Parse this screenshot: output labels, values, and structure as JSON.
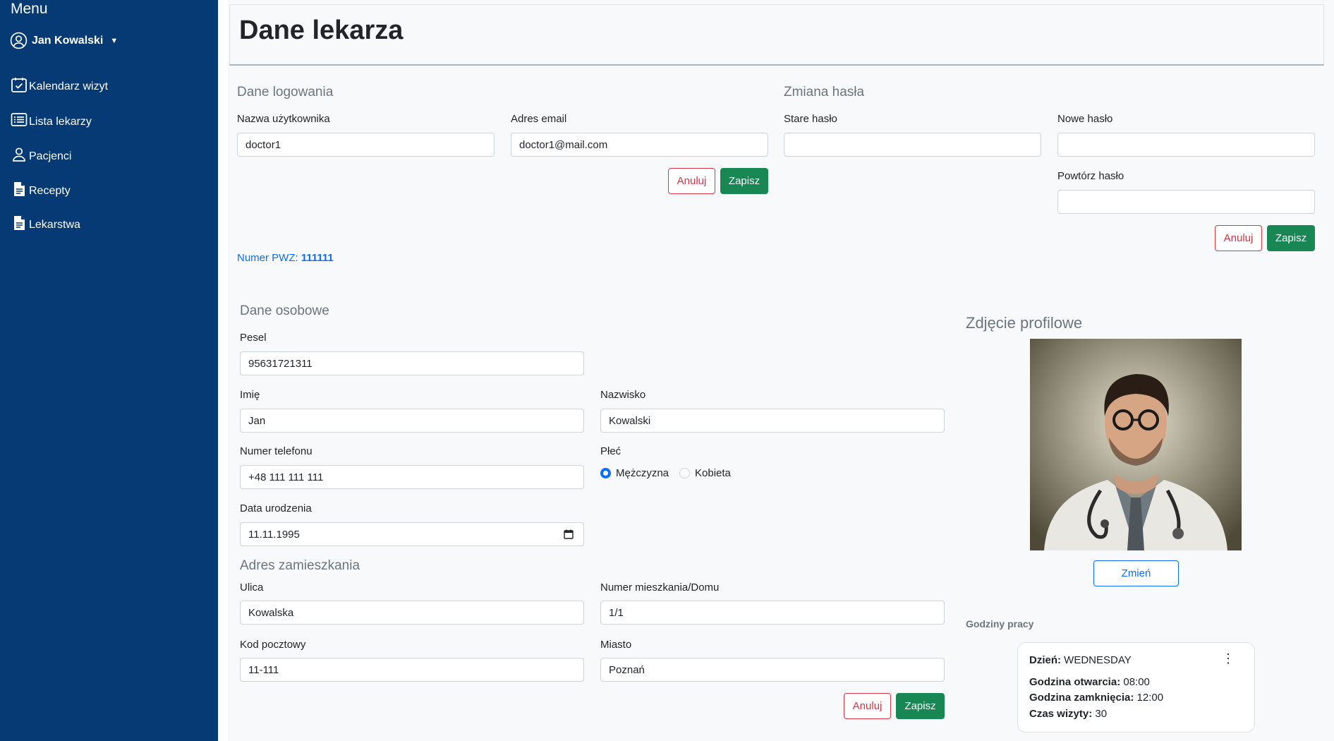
{
  "sidebar": {
    "menu_title": "Menu",
    "user_name": "Jan Kowalski",
    "items": [
      {
        "label": "Kalendarz wizyt",
        "icon": "calendar-check-icon"
      },
      {
        "label": "Lista lekarzy",
        "icon": "list-icon"
      },
      {
        "label": "Pacjenci",
        "icon": "person-icon"
      },
      {
        "label": "Recepty",
        "icon": "document-icon"
      },
      {
        "label": "Lekarstwa",
        "icon": "document-icon"
      }
    ],
    "background_color": "#063a74"
  },
  "page": {
    "title": "Dane lekarza"
  },
  "login_data": {
    "section_title": "Dane logowania",
    "username_label": "Nazwa użytkownika",
    "username_value": "doctor1",
    "email_label": "Adres email",
    "email_value": "doctor1@mail.com",
    "cancel_label": "Anuluj",
    "save_label": "Zapisz"
  },
  "password_change": {
    "section_title": "Zmiana hasła",
    "old_password_label": "Stare hasło",
    "new_password_label": "Nowe hasło",
    "repeat_password_label": "Powtórz hasło",
    "cancel_label": "Anuluj",
    "save_label": "Zapisz"
  },
  "pwz": {
    "label": "Numer PWZ:",
    "value": "111111"
  },
  "personal_data": {
    "section_title": "Dane osobowe",
    "pesel_label": "Pesel",
    "pesel_value": "95631721311",
    "first_name_label": "Imię",
    "first_name_value": "Jan",
    "last_name_label": "Nazwisko",
    "last_name_value": "Kowalski",
    "phone_label": "Numer telefonu",
    "phone_value": "+48 111 111 111",
    "gender_label": "Płeć",
    "gender_options": [
      "Mężczyzna",
      "Kobieta"
    ],
    "gender_selected": "Mężczyzna",
    "birth_date_label": "Data urodzenia",
    "birth_date_value": "11.11.1995"
  },
  "address": {
    "section_title": "Adres zamieszkania",
    "street_label": "Ulica",
    "street_value": "Kowalska",
    "house_number_label": "Numer mieszkania/Domu",
    "house_number_value": "1/1",
    "postal_code_label": "Kod pocztowy",
    "postal_code_value": "11-111",
    "city_label": "Miasto",
    "city_value": "Poznań",
    "cancel_label": "Anuluj",
    "save_label": "Zapisz"
  },
  "profile_photo": {
    "section_title": "Zdjęcie profilowe",
    "change_label": "Zmień"
  },
  "working_hours": {
    "section_title": "Godziny pracy",
    "day_label": "Dzień:",
    "day_value": "WEDNESDAY",
    "open_label": "Godzina otwarcia:",
    "open_value": "08:00",
    "close_label": "Godzina zamknięcia:",
    "close_value": "12:00",
    "visit_label": "Czas wizyty:",
    "visit_value": "30"
  },
  "colors": {
    "primary": "#0d6efd",
    "success": "#198754",
    "danger": "#dc3545"
  }
}
